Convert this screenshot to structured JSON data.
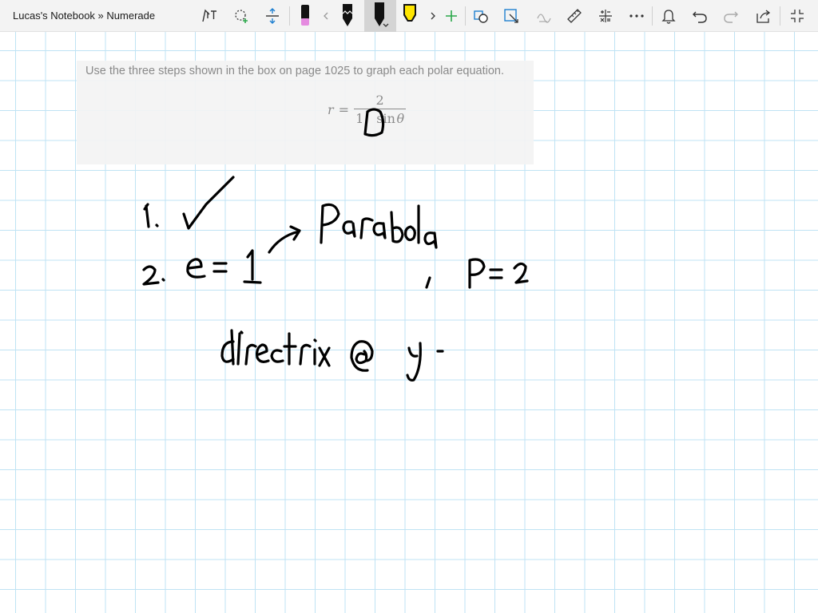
{
  "app": {
    "title": "Lucas's Notebook » Numerade"
  },
  "toolbar": {
    "items": [
      {
        "name": "type-to-ink-icon",
        "label": "Type"
      },
      {
        "name": "lasso-select-icon",
        "label": "Lasso select"
      },
      {
        "name": "add-space-icon",
        "label": "Add space"
      },
      {
        "name": "eraser-icon",
        "label": "Eraser"
      },
      {
        "name": "scroll-left-icon",
        "label": "Previous pens"
      },
      {
        "name": "pencil-icon",
        "label": "Pencil"
      },
      {
        "name": "pen-black-icon",
        "label": "Pen"
      },
      {
        "name": "highlighter-yellow-icon",
        "label": "Highlighter"
      },
      {
        "name": "scroll-right-icon",
        "label": "More pens"
      },
      {
        "name": "add-pen-icon",
        "label": "Add pen"
      },
      {
        "name": "shapes-icon",
        "label": "Shapes"
      },
      {
        "name": "ink-to-shape-icon",
        "label": "Ink to shape"
      },
      {
        "name": "ink-to-math-icon",
        "label": "Math"
      },
      {
        "name": "ruler-icon",
        "label": "Ruler"
      },
      {
        "name": "math-icon",
        "label": "Math"
      },
      {
        "name": "more-icon",
        "label": "More"
      },
      {
        "name": "notifications-icon",
        "label": "Notifications"
      },
      {
        "name": "undo-icon",
        "label": "Undo"
      },
      {
        "name": "redo-icon",
        "label": "Redo"
      },
      {
        "name": "share-icon",
        "label": "Share"
      },
      {
        "name": "fullscreen-icon",
        "label": "Full screen"
      }
    ],
    "colors": {
      "pen_black": "#111111",
      "highlighter_yellow": "#ffe600",
      "eraser_pink": "#e58be0",
      "accent_blue": "#1e7fd0",
      "accent_green": "#2aa84a"
    }
  },
  "problem": {
    "instruction": "Use the three steps shown in the box on page 1025 to graph each polar equation.",
    "equation": {
      "lhs": "r",
      "equals": "=",
      "numerator": "2",
      "denominator_prefix": "1",
      "denominator_suffix": "sin",
      "denominator_var": "θ"
    }
  },
  "handwriting": {
    "lines": [
      "1. ✓",
      "2. e = 1 → Parabola , P = 2",
      "directrix @ y -"
    ]
  },
  "canvas": {
    "grid_color": "#bfe3f4",
    "ink_color": "#000000"
  }
}
